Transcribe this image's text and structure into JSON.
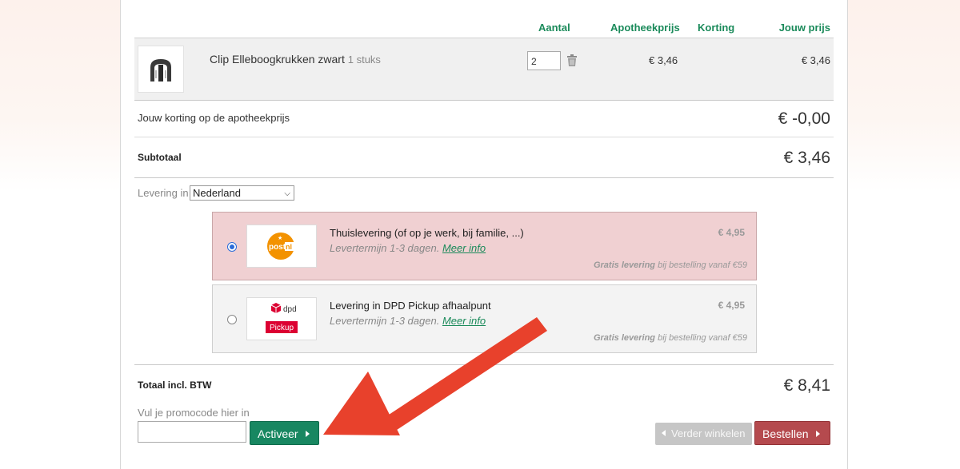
{
  "table": {
    "headers": {
      "qty": "Aantal",
      "pharmacy_price": "Apotheekprijs",
      "discount": "Korting",
      "your_price": "Jouw prijs"
    },
    "item": {
      "name": "Clip Elleboogkrukken zwart",
      "count_label": "1 stuks",
      "qty_value": "2",
      "pharmacy_price": "€ 3,46",
      "your_price": "€ 3,46"
    }
  },
  "summary": {
    "discount_label": "Jouw korting op de apotheekprijs",
    "discount_value": "€ -0,00",
    "subtotal_label": "Subtotaal",
    "subtotal_value": "€ 3,46",
    "total_label": "Totaal incl. BTW",
    "total_value": "€ 8,41"
  },
  "delivery": {
    "label": "Levering in",
    "country": "Nederland",
    "options": [
      {
        "title": "Thuislevering (of op je werk, bij familie, ...)",
        "term": "Levertermijn 1-3 dagen.",
        "more": "Meer info",
        "price": "€ 4,95",
        "free_bold": "Gratis levering",
        "free_rest": "bij bestelling vanaf €59",
        "logo": "postnl",
        "selected": true
      },
      {
        "title": "Levering in DPD Pickup afhaalpunt",
        "term": "Levertermijn 1-3 dagen.",
        "more": "Meer info",
        "price": "€ 4,95",
        "free_bold": "Gratis levering",
        "free_rest": "bij bestelling vanaf €59",
        "logo": "dpd",
        "selected": false
      }
    ]
  },
  "logos": {
    "postnl": "post",
    "postnl_nl": "nl",
    "dpd": "dpd",
    "dpd_pickup": "Pickup"
  },
  "promo": {
    "label": "Vul je promocode hier in",
    "value": "",
    "button": "Activeer"
  },
  "actions": {
    "continue": "Verder winkelen",
    "order": "Bestellen"
  },
  "colors": {
    "accent_green": "#188761",
    "order_red": "#b54a4e",
    "arrow": "#e8412c",
    "selected_bg": "#f0d0d2"
  }
}
